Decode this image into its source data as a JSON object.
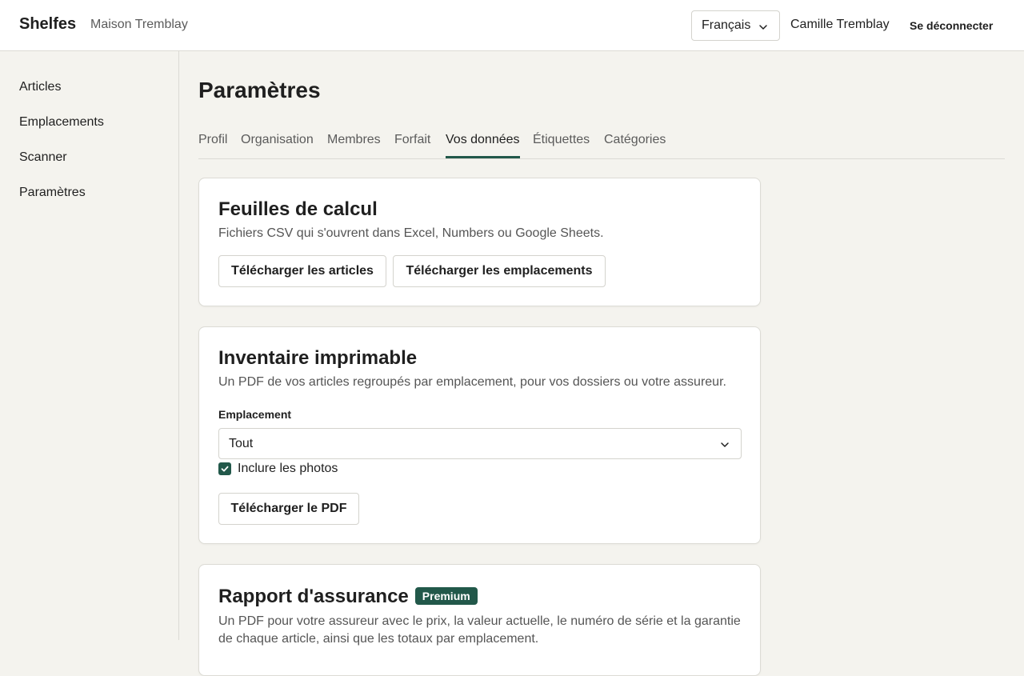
{
  "header": {
    "brand": "Shelfes",
    "household": "Maison Tremblay",
    "language": "Français",
    "user": "Camille Tremblay",
    "logout": "Se déconnecter"
  },
  "sidebar": {
    "items": [
      {
        "label": "Articles"
      },
      {
        "label": "Emplacements"
      },
      {
        "label": "Scanner"
      },
      {
        "label": "Paramètres"
      }
    ]
  },
  "main": {
    "title": "Paramètres",
    "tabs": [
      {
        "label": "Profil"
      },
      {
        "label": "Organisation"
      },
      {
        "label": "Membres"
      },
      {
        "label": "Forfait"
      },
      {
        "label": "Vos données",
        "active": true
      },
      {
        "label": "Étiquettes"
      },
      {
        "label": "Catégories"
      }
    ],
    "spreadsheets": {
      "title": "Feuilles de calcul",
      "description": "Fichiers CSV qui s'ouvrent dans Excel, Numbers ou Google Sheets.",
      "download_items": "Télécharger les articles",
      "download_locations": "Télécharger les emplacements"
    },
    "printable": {
      "title": "Inventaire imprimable",
      "description": "Un PDF de vos articles regroupés par emplacement, pour vos dossiers ou votre assureur.",
      "location_label": "Emplacement",
      "location_value": "Tout",
      "include_photos_label": "Inclure les photos",
      "include_photos_checked": true,
      "download_pdf": "Télécharger le PDF"
    },
    "insurance": {
      "title": "Rapport d'assurance",
      "badge": "Premium",
      "description": "Un PDF pour votre assureur avec le prix, la valeur actuelle, le numéro de série et la garantie de chaque article, ainsi que les totaux par emplacement."
    }
  },
  "colors": {
    "accent": "#22584a",
    "background": "#f4f3ee",
    "surface": "#ffffff",
    "border": "#dcdbd5"
  },
  "icons": [
    "chevron-down-icon",
    "checkmark-icon"
  ]
}
